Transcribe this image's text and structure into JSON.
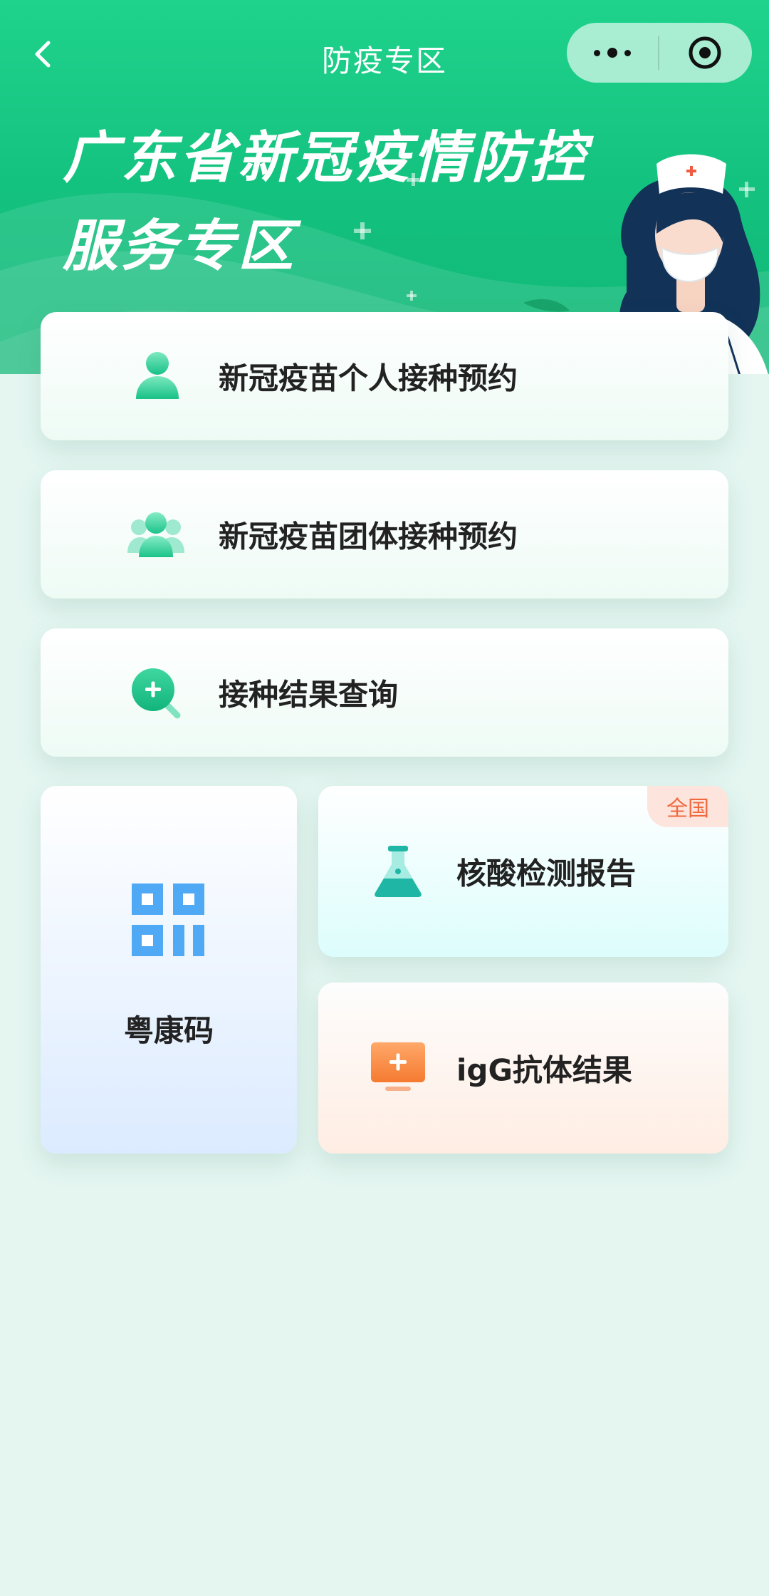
{
  "nav": {
    "title": "防疫专区"
  },
  "hero": {
    "title_line1": "广东省新冠疫情防控",
    "title_line2": "服务专区"
  },
  "services": [
    {
      "label": "新冠疫苗个人接种预约",
      "icon": "person-icon"
    },
    {
      "label": "新冠疫苗团体接种预约",
      "icon": "group-icon"
    },
    {
      "label": "接种结果查询",
      "icon": "search-plus-icon"
    }
  ],
  "health_code": {
    "label": "粤康码",
    "icon": "qr-code-icon"
  },
  "nucleic_test": {
    "label": "核酸检测报告",
    "badge": "全国",
    "icon": "flask-icon"
  },
  "antibody": {
    "label": "igG抗体结果",
    "icon": "monitor-plus-icon"
  },
  "colors": {
    "brand_green": "#13c07e",
    "badge_orange": "#f06a40",
    "qr_blue": "#4fa9f5",
    "flask_teal": "#1fb6a5",
    "monitor_orange": "#f58a3c"
  }
}
